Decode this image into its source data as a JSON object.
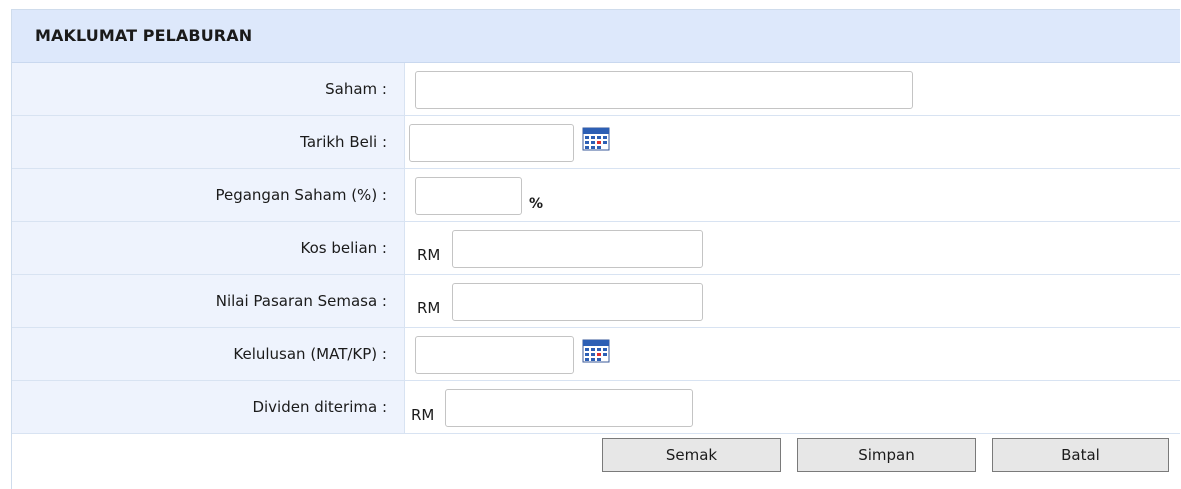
{
  "section": {
    "title": "MAKLUMAT PELABURAN"
  },
  "fields": [
    {
      "label": "Saham :",
      "value": "",
      "prefix": "",
      "suffix": "",
      "has_calendar": false
    },
    {
      "label": "Tarikh Beli :",
      "value": "",
      "prefix": "",
      "suffix": "",
      "has_calendar": true
    },
    {
      "label": "Pegangan Saham (%) :",
      "value": "",
      "prefix": "",
      "suffix": "%",
      "has_calendar": false
    },
    {
      "label": "Kos belian :",
      "value": "",
      "prefix": "RM",
      "suffix": "",
      "has_calendar": false
    },
    {
      "label": "Nilai Pasaran Semasa :",
      "value": "",
      "prefix": "RM",
      "suffix": "",
      "has_calendar": false
    },
    {
      "label": "Kelulusan (MAT/KP) :",
      "value": "",
      "prefix": "",
      "suffix": "",
      "has_calendar": true
    },
    {
      "label": "Dividen diterima :",
      "value": "",
      "prefix": "RM",
      "suffix": "",
      "has_calendar": false
    }
  ],
  "buttons": {
    "check": "Semak",
    "save": "Simpan",
    "cancel": "Batal"
  },
  "colors": {
    "header_bg": "#dde8fb",
    "label_bg": "#eef3fd",
    "border": "#d8e3f2"
  },
  "icons": {
    "calendar": "calendar-icon"
  }
}
